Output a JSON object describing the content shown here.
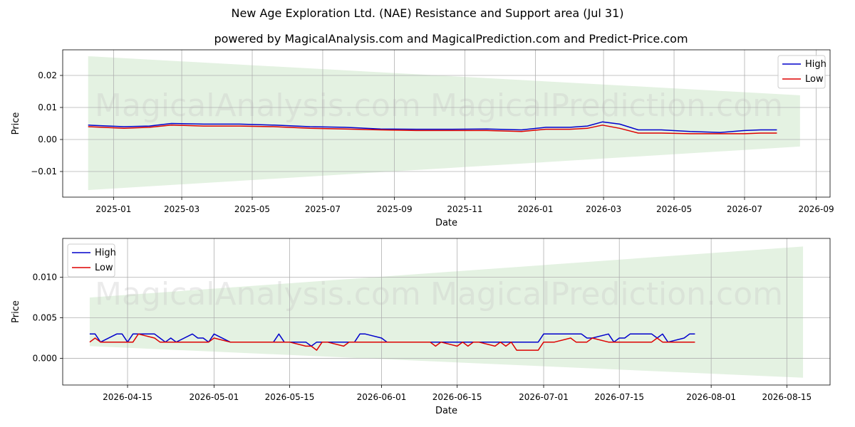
{
  "title": "New Age Exploration Ltd. (NAE) Resistance and Support area (Jul 31)",
  "subtitle": "powered by MagicalAnalysis.com and MagicalPrediction.com and Predict-Price.com",
  "watermarks": [
    "MagicalAnalysis.com",
    "MagicalPrediction.com"
  ],
  "colors": {
    "high": "#0000cc",
    "low": "#dd0000",
    "band": "#d9ecd5",
    "grid": "#b0b0b0"
  },
  "chart_data": [
    {
      "type": "line",
      "xlabel": "Date",
      "ylabel": "Price",
      "xlim": [
        "2024-11-18",
        "2026-09-13"
      ],
      "ylim": [
        -0.018,
        0.028
      ],
      "x_ticks": [
        "2025-01-01",
        "2025-03-01",
        "2025-05-01",
        "2025-07-01",
        "2025-09-01",
        "2025-11-01",
        "2026-01-01",
        "2026-03-01",
        "2026-05-01",
        "2026-07-01",
        "2026-09-01"
      ],
      "x_tick_labels": [
        "2025-01",
        "2025-03",
        "2025-05",
        "2025-07",
        "2025-09",
        "2025-11",
        "2026-01",
        "2026-03",
        "2026-05",
        "2026-07",
        "2026-09"
      ],
      "y_ticks": [
        -0.01,
        0.0,
        0.01,
        0.02
      ],
      "y_tick_labels": [
        "−0.01",
        "0.00",
        "0.01",
        "0.02"
      ],
      "legend": {
        "position": "top-right",
        "entries": [
          "High",
          "Low"
        ]
      },
      "grid": true,
      "band": {
        "x": [
          "2024-12-10",
          "2026-08-18"
        ],
        "upper": [
          0.026,
          0.0138
        ],
        "lower": [
          -0.0158,
          -0.0022
        ]
      },
      "series": [
        {
          "name": "High",
          "x": [
            "2024-12-10",
            "2025-01-10",
            "2025-02-01",
            "2025-02-20",
            "2025-03-20",
            "2025-04-20",
            "2025-05-20",
            "2025-06-20",
            "2025-07-20",
            "2025-08-20",
            "2025-09-20",
            "2025-10-20",
            "2025-11-20",
            "2025-12-20",
            "2026-01-10",
            "2026-01-31",
            "2026-02-15",
            "2026-02-28",
            "2026-03-15",
            "2026-03-31",
            "2026-04-20",
            "2026-05-15",
            "2026-06-10",
            "2026-07-01",
            "2026-07-15",
            "2026-07-29"
          ],
          "values": [
            0.0045,
            0.004,
            0.0042,
            0.005,
            0.0048,
            0.0048,
            0.0045,
            0.004,
            0.0038,
            0.0033,
            0.0032,
            0.0032,
            0.0033,
            0.003,
            0.0038,
            0.0038,
            0.0042,
            0.0055,
            0.0048,
            0.003,
            0.003,
            0.0025,
            0.0022,
            0.0028,
            0.003,
            0.003
          ]
        },
        {
          "name": "Low",
          "x": [
            "2024-12-10",
            "2025-01-10",
            "2025-02-01",
            "2025-02-20",
            "2025-03-20",
            "2025-04-20",
            "2025-05-20",
            "2025-06-20",
            "2025-07-20",
            "2025-08-20",
            "2025-09-20",
            "2025-10-20",
            "2025-11-20",
            "2025-12-20",
            "2026-01-10",
            "2026-01-31",
            "2026-02-15",
            "2026-02-28",
            "2026-03-15",
            "2026-03-31",
            "2026-04-20",
            "2026-05-15",
            "2026-06-10",
            "2026-07-01",
            "2026-07-15",
            "2026-07-29"
          ],
          "values": [
            0.004,
            0.0035,
            0.0038,
            0.0045,
            0.0042,
            0.0042,
            0.004,
            0.0035,
            0.0033,
            0.003,
            0.0028,
            0.0028,
            0.0028,
            0.0025,
            0.0032,
            0.0032,
            0.0035,
            0.0045,
            0.0035,
            0.002,
            0.002,
            0.0018,
            0.0018,
            0.0018,
            0.002,
            0.002
          ]
        }
      ]
    },
    {
      "type": "line",
      "xlabel": "Date",
      "ylabel": "Price",
      "xlim": [
        "2026-04-03",
        "2026-08-23"
      ],
      "ylim": [
        -0.0033,
        0.0148
      ],
      "x_ticks": [
        "2026-04-15",
        "2026-05-01",
        "2026-05-15",
        "2026-06-01",
        "2026-06-15",
        "2026-07-01",
        "2026-07-15",
        "2026-08-01",
        "2026-08-15"
      ],
      "x_tick_labels": [
        "2026-04-15",
        "2026-05-01",
        "2026-05-15",
        "2026-06-01",
        "2026-06-15",
        "2026-07-01",
        "2026-07-15",
        "2026-08-01",
        "2026-08-15"
      ],
      "y_ticks": [
        0.0,
        0.005,
        0.01
      ],
      "y_tick_labels": [
        "0.000",
        "0.005",
        "0.010"
      ],
      "legend": {
        "position": "top-left",
        "entries": [
          "High",
          "Low"
        ]
      },
      "grid": true,
      "band": {
        "x": [
          "2026-04-08",
          "2026-08-18"
        ],
        "upper": [
          0.0075,
          0.0138
        ],
        "lower": [
          0.0015,
          -0.0024
        ]
      },
      "series": [
        {
          "name": "High",
          "x": [
            "2026-04-08",
            "2026-04-09",
            "2026-04-10",
            "2026-04-13",
            "2026-04-14",
            "2026-04-15",
            "2026-04-16",
            "2026-04-17",
            "2026-04-20",
            "2026-04-21",
            "2026-04-22",
            "2026-04-23",
            "2026-04-24",
            "2026-04-27",
            "2026-04-28",
            "2026-04-29",
            "2026-04-30",
            "2026-05-01",
            "2026-05-04",
            "2026-05-05",
            "2026-05-06",
            "2026-05-07",
            "2026-05-08",
            "2026-05-11",
            "2026-05-12",
            "2026-05-13",
            "2026-05-14",
            "2026-05-15",
            "2026-05-18",
            "2026-05-19",
            "2026-05-20",
            "2026-05-21",
            "2026-05-22",
            "2026-05-25",
            "2026-05-26",
            "2026-05-27",
            "2026-05-28",
            "2026-05-29",
            "2026-06-01",
            "2026-06-02",
            "2026-06-03",
            "2026-06-04",
            "2026-06-05",
            "2026-06-08",
            "2026-06-09",
            "2026-06-10",
            "2026-06-11",
            "2026-06-12",
            "2026-06-15",
            "2026-06-16",
            "2026-06-17",
            "2026-06-18",
            "2026-06-19",
            "2026-06-22",
            "2026-06-23",
            "2026-06-24",
            "2026-06-25",
            "2026-06-26",
            "2026-06-29",
            "2026-06-30",
            "2026-07-01",
            "2026-07-02",
            "2026-07-03",
            "2026-07-06",
            "2026-07-07",
            "2026-07-08",
            "2026-07-09",
            "2026-07-10",
            "2026-07-13",
            "2026-07-14",
            "2026-07-15",
            "2026-07-16",
            "2026-07-17",
            "2026-07-20",
            "2026-07-21",
            "2026-07-22",
            "2026-07-23",
            "2026-07-24",
            "2026-07-27",
            "2026-07-28",
            "2026-07-29"
          ],
          "values": [
            0.003,
            0.003,
            0.002,
            0.003,
            0.003,
            0.002,
            0.003,
            0.003,
            0.003,
            0.0025,
            0.002,
            0.0025,
            0.002,
            0.003,
            0.0025,
            0.0025,
            0.002,
            0.003,
            0.002,
            0.002,
            0.002,
            0.002,
            0.002,
            0.002,
            0.002,
            0.003,
            0.002,
            0.002,
            0.002,
            0.0015,
            0.002,
            0.002,
            0.002,
            0.002,
            0.002,
            0.002,
            0.003,
            0.003,
            0.0025,
            0.002,
            0.002,
            0.002,
            0.002,
            0.002,
            0.002,
            0.002,
            0.002,
            0.002,
            0.002,
            0.002,
            0.002,
            0.002,
            0.002,
            0.002,
            0.002,
            0.002,
            0.002,
            0.002,
            0.002,
            0.002,
            0.003,
            0.003,
            0.003,
            0.003,
            0.003,
            0.003,
            0.0025,
            0.0025,
            0.003,
            0.002,
            0.0025,
            0.0025,
            0.003,
            0.003,
            0.003,
            0.0025,
            0.003,
            0.002,
            0.0025,
            0.003,
            0.003
          ]
        },
        {
          "name": "Low",
          "x": [
            "2026-04-08",
            "2026-04-09",
            "2026-04-10",
            "2026-04-13",
            "2026-04-14",
            "2026-04-15",
            "2026-04-16",
            "2026-04-17",
            "2026-04-20",
            "2026-04-21",
            "2026-04-22",
            "2026-04-23",
            "2026-04-24",
            "2026-04-27",
            "2026-04-28",
            "2026-04-29",
            "2026-04-30",
            "2026-05-01",
            "2026-05-04",
            "2026-05-05",
            "2026-05-06",
            "2026-05-07",
            "2026-05-08",
            "2026-05-11",
            "2026-05-12",
            "2026-05-13",
            "2026-05-14",
            "2026-05-15",
            "2026-05-18",
            "2026-05-19",
            "2026-05-20",
            "2026-05-21",
            "2026-05-22",
            "2026-05-25",
            "2026-05-26",
            "2026-05-27",
            "2026-05-28",
            "2026-05-29",
            "2026-06-01",
            "2026-06-02",
            "2026-06-03",
            "2026-06-04",
            "2026-06-05",
            "2026-06-08",
            "2026-06-09",
            "2026-06-10",
            "2026-06-11",
            "2026-06-12",
            "2026-06-15",
            "2026-06-16",
            "2026-06-17",
            "2026-06-18",
            "2026-06-19",
            "2026-06-22",
            "2026-06-23",
            "2026-06-24",
            "2026-06-25",
            "2026-06-26",
            "2026-06-29",
            "2026-06-30",
            "2026-07-01",
            "2026-07-02",
            "2026-07-03",
            "2026-07-06",
            "2026-07-07",
            "2026-07-08",
            "2026-07-09",
            "2026-07-10",
            "2026-07-13",
            "2026-07-14",
            "2026-07-15",
            "2026-07-16",
            "2026-07-17",
            "2026-07-20",
            "2026-07-21",
            "2026-07-22",
            "2026-07-23",
            "2026-07-24",
            "2026-07-27",
            "2026-07-28",
            "2026-07-29"
          ],
          "values": [
            0.002,
            0.0025,
            0.002,
            0.002,
            0.002,
            0.002,
            0.002,
            0.003,
            0.0025,
            0.002,
            0.002,
            0.002,
            0.002,
            0.002,
            0.002,
            0.002,
            0.002,
            0.0025,
            0.002,
            0.002,
            0.002,
            0.002,
            0.002,
            0.002,
            0.002,
            0.002,
            0.002,
            0.002,
            0.0015,
            0.0015,
            0.001,
            0.002,
            0.002,
            0.0015,
            0.002,
            0.002,
            0.002,
            0.002,
            0.002,
            0.002,
            0.002,
            0.002,
            0.002,
            0.002,
            0.002,
            0.002,
            0.0015,
            0.002,
            0.0015,
            0.002,
            0.0015,
            0.002,
            0.002,
            0.0015,
            0.002,
            0.0015,
            0.002,
            0.001,
            0.001,
            0.001,
            0.002,
            0.002,
            0.002,
            0.0025,
            0.002,
            0.002,
            0.002,
            0.0025,
            0.002,
            0.002,
            0.002,
            0.002,
            0.002,
            0.002,
            0.002,
            0.0025,
            0.002,
            0.002,
            0.002,
            0.002,
            0.002
          ]
        }
      ]
    }
  ]
}
